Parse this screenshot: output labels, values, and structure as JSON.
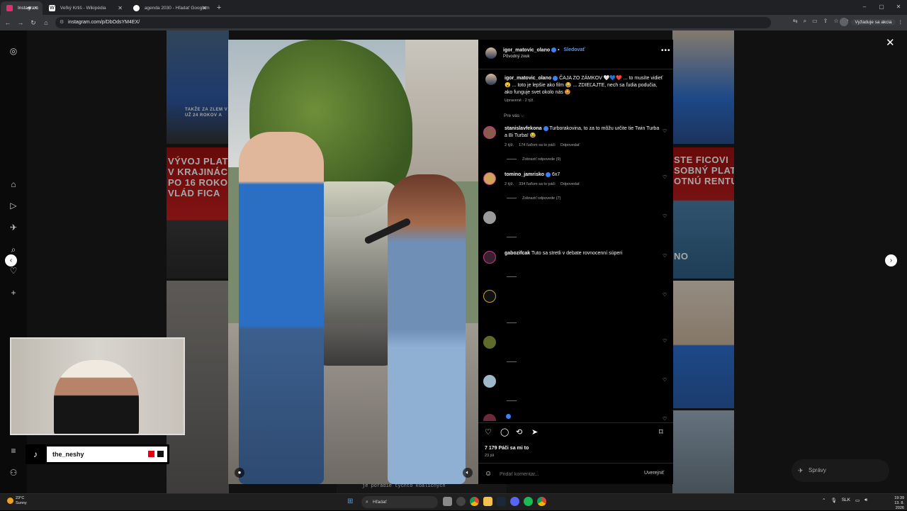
{
  "browser": {
    "tabs": [
      {
        "title": "Instagram",
        "active": true,
        "color": "#e1306c"
      },
      {
        "title": "Veľký Krtiš - Wikipédia",
        "active": false,
        "color": "#ffffff"
      },
      {
        "title": "agenda 2030 - Hľadať Googlom",
        "active": false,
        "color": "#4285f4"
      }
    ],
    "new_tab": "+",
    "url": "instagram.com/p/DbOdsYM4EX/",
    "action_pill": "Vyžaduje sa akcia",
    "window_controls": [
      "–",
      "▢",
      "✕"
    ]
  },
  "page": {
    "grid_texts": [
      "TAKŽE ZA ZLEM V\nUŽ 24 ROKOV A",
      "VÝVOJ PLAT\nV KRAJINÁC\nPO 16 ROKOC\nVLÁD FICA",
      "STE FICOVI\nSOBNÝ PLAT\nOTNÚ RENTU?",
      "NO",
      "je poradie týchto koaličných"
    ],
    "messages_label": "Správy"
  },
  "post": {
    "author": "igor_matovic_olano",
    "follow_label": "Sledovať",
    "audio_label": "Pôvodný zvuk",
    "caption_author": "igor_matovic_olano",
    "caption_text": "ČAJA ZO ZÁMKOV 🤍💙❤️ ... to musíte vidieť 😮 ... toto je lepšie ako film 😂 ... ZDIEĽAJTE, nech sa ľudia podučia, ako funguje svet okolo nás 🤩",
    "caption_meta": "Upravené · 2 týž.",
    "for_you_label": "Pre vás ⌵",
    "likes_text": "7 179 Páči sa mi to",
    "date_text": "23 júl",
    "comment_placeholder": "Pridať komentár...",
    "post_button": "Uverejniť"
  },
  "comments": [
    {
      "user": "stanislavfekona",
      "verified": true,
      "text": "Turborakovina, to za to môžu určite tie Twin Turba a Bi Turba! 😂",
      "age": "2 týž.",
      "likes": "174 ľuďom sa to páči",
      "reply": "Odpovedať",
      "translate": "",
      "replies": "Zobraziť odpovede (9)"
    },
    {
      "user": "tomino_jamrisko",
      "verified": true,
      "text": "6x7",
      "age": "2 týž.",
      "likes": "334 ľuďom sa to páči",
      "reply": "Odpovedať",
      "translate": "",
      "replies": "Zobraziť odpovede (7)"
    },
    "…",
    {
      "user": "gabozifcak",
      "verified": true,
      "text": "Tuto sa stretli v debate rovnocenní súperi",
      "age": "",
      "likes": "",
      "reply": "",
      "translate": "",
      "replies": ""
    }
  ],
  "taskbar": {
    "temp": "23°C",
    "condition": "Sunny",
    "search_label": "Hľadať",
    "lang": "SLK",
    "time": "19:39",
    "date": "13. 8. 2026"
  }
}
